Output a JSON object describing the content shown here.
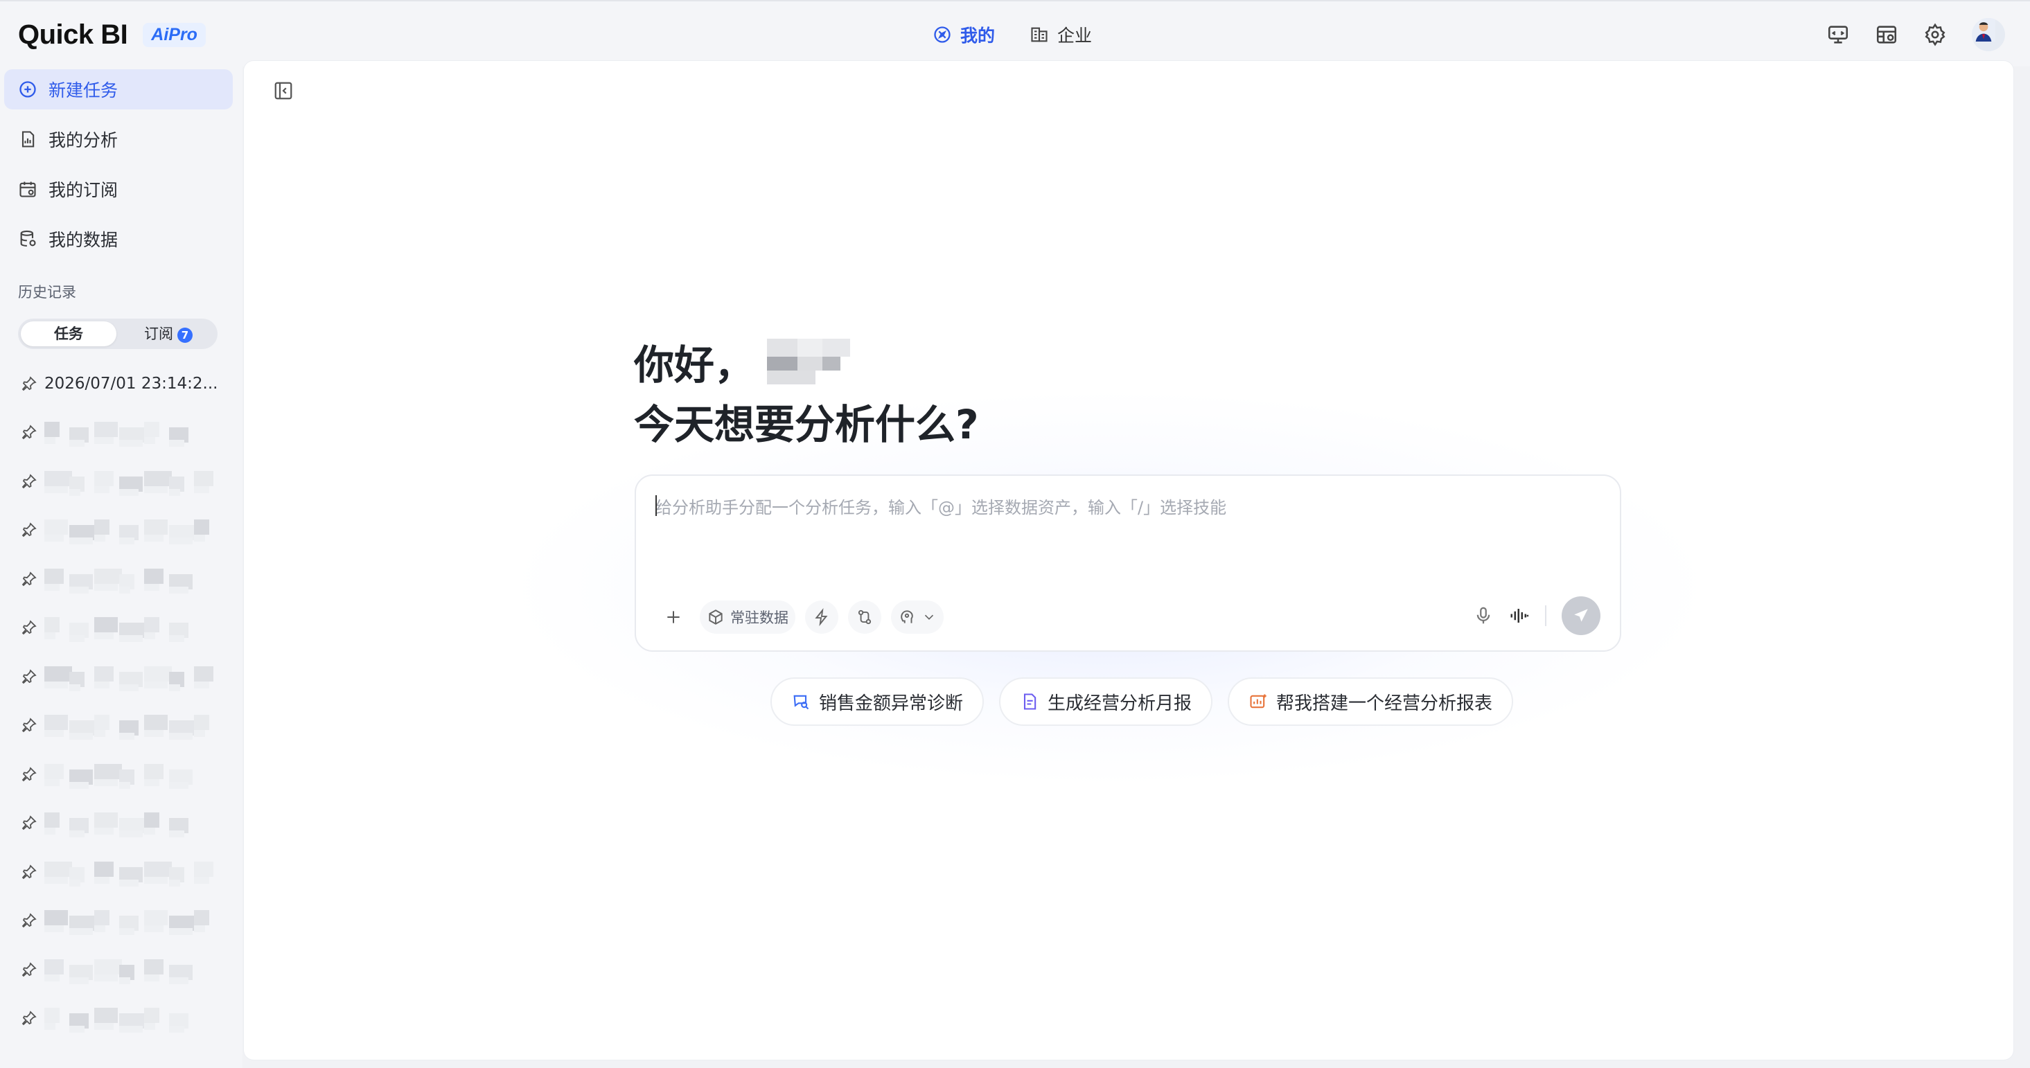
{
  "brand": {
    "name": "Quick BI",
    "badge": "AiPro"
  },
  "topnav": [
    {
      "label": "我的",
      "icon": "compass-icon",
      "active": true
    },
    {
      "label": "企业",
      "icon": "building-icon",
      "active": false
    }
  ],
  "toolbar": {
    "icons": [
      "monitor-icon",
      "table-icon",
      "gear-icon"
    ],
    "avatar": "avatar"
  },
  "sidebar": {
    "nav": [
      {
        "label": "新建任务",
        "icon": "plus-circle-icon",
        "active": true
      },
      {
        "label": "我的分析",
        "icon": "document-chart-icon",
        "active": false
      },
      {
        "label": "我的订阅",
        "icon": "calendar-icon",
        "active": false
      },
      {
        "label": "我的数据",
        "icon": "database-icon",
        "active": false
      }
    ],
    "history_title": "历史记录",
    "segments": {
      "tasks": "任务",
      "subscriptions": "订阅",
      "subscriptions_badge": "7"
    },
    "history": [
      {
        "label": "2026/07/01 23:14:2..."
      }
    ]
  },
  "main": {
    "greeting": "你好，",
    "question": "今天想要分析什么?",
    "input": {
      "placeholder": "给分析助手分配一个分析任务，输入「@」选择数据资产，输入「/」选择技能",
      "resident_data": "常驻数据"
    },
    "suggestions": [
      {
        "label": "销售金额异常诊断",
        "color": "#3b6cf5"
      },
      {
        "label": "生成经营分析月报",
        "color": "#6b5cf0"
      },
      {
        "label": "帮我搭建一个经营分析报表",
        "color": "#e8743b"
      }
    ]
  }
}
